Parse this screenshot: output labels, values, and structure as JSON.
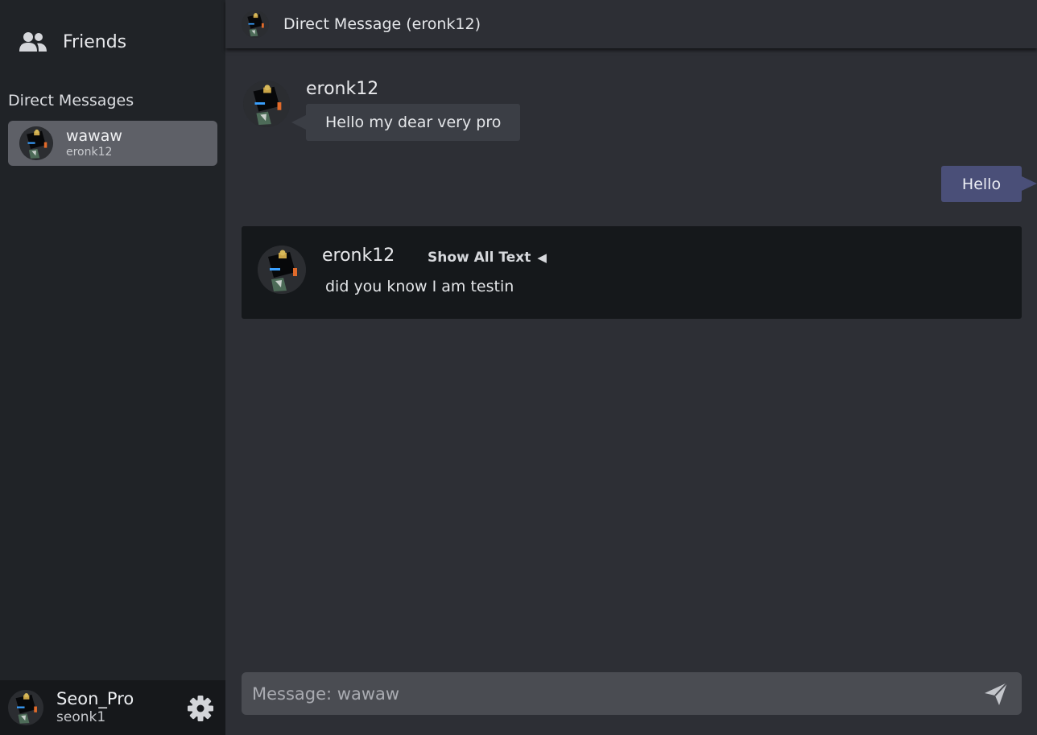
{
  "sidebar": {
    "friends_label": "Friends",
    "dm_heading": "Direct Messages",
    "dm_items": [
      {
        "name": "wawaw",
        "subtitle": "eronk12",
        "selected": true
      }
    ]
  },
  "user_panel": {
    "display_name": "Seon_Pro",
    "username": "seonk1"
  },
  "header": {
    "title": "Direct Message (eronk12)"
  },
  "messages": [
    {
      "author": "eronk12",
      "text": "Hello my dear very pro",
      "direction": "incoming"
    },
    {
      "author": "",
      "text": "Hello",
      "direction": "outgoing"
    },
    {
      "author": "eronk12",
      "text": "did you know I am testin",
      "direction": "incoming-block",
      "toggle_label": "Show All Text",
      "toggle_icon": "◀"
    }
  ],
  "composer": {
    "placeholder": "Message: wawaw",
    "value": ""
  },
  "icons": {
    "friends": "users-icon",
    "settings": "gear-icon",
    "send": "send-icon"
  },
  "colors": {
    "sidebar_bg": "#202327",
    "main_bg": "#2d2f35",
    "selected_dm_bg": "#5e6067",
    "incoming_bubble": "#3b3e45",
    "outgoing_bubble": "#4a4f78",
    "block_bg": "#15181b",
    "composer_bg": "#4a4c52"
  }
}
